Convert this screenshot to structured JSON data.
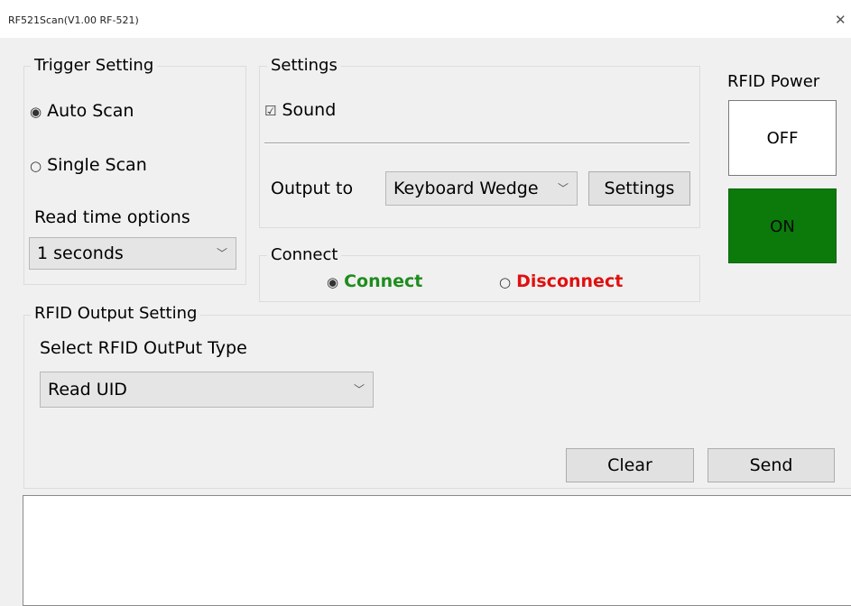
{
  "window": {
    "title": "RF521Scan(V1.00 RF-521)",
    "close_glyph": "✕"
  },
  "trigger": {
    "legend": "Trigger Setting",
    "auto_scan": "Auto Scan",
    "single_scan": "Single Scan",
    "selected": "Auto Scan",
    "read_time_label": "Read time options",
    "read_time_value": "1 seconds"
  },
  "settings": {
    "legend": "Settings",
    "sound_label": "Sound",
    "output_label": "Output to",
    "output_value": "Keyboard Wedge",
    "settings_button": "Settings"
  },
  "connect": {
    "legend": "Connect",
    "connect_label": "Connect",
    "disconnect_label": "Disconnect",
    "selected": "Connect",
    "connect_color": "#1e8c1e",
    "disconnect_color": "#e01010"
  },
  "power": {
    "label": "RFID Power",
    "off_label": "OFF",
    "on_label": "ON",
    "on_color": "#0b7a0b"
  },
  "rfid_output": {
    "legend": "RFID Output Setting",
    "type_label": "Select RFID OutPut Type",
    "type_value": "Read UID"
  },
  "actions": {
    "clear": "Clear",
    "send": "Send"
  },
  "output_text": ""
}
